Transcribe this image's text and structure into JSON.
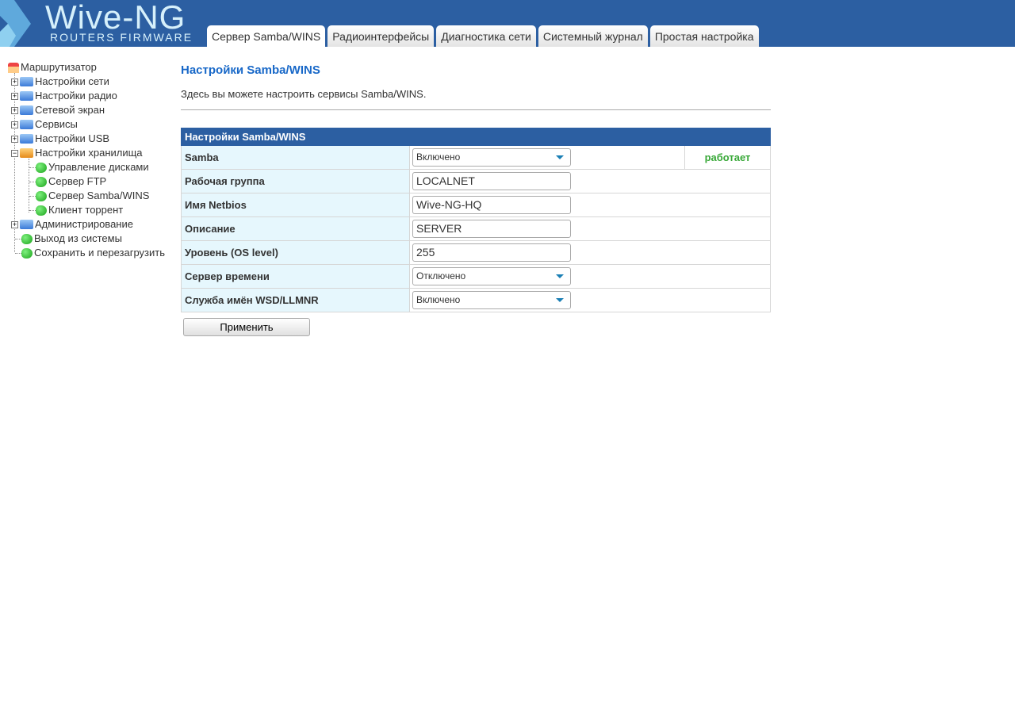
{
  "logo": {
    "title": "Wive-NG",
    "subtitle": "ROUTERS FIRMWARE"
  },
  "tabs": [
    "Сервер Samba/WINS",
    "Радиоинтерфейсы",
    "Диагностика сети",
    "Системный журнал",
    "Простая настройка"
  ],
  "tree": {
    "root": "Маршрутизатор",
    "items": [
      "Настройки сети",
      "Настройки радио",
      "Сетевой экран",
      "Сервисы",
      "Настройки USB",
      "Настройки хранилища"
    ],
    "storage_children": [
      "Управление дисками",
      "Сервер FTP",
      "Сервер Samba/WINS",
      "Клиент торрент"
    ],
    "admin": "Администрирование",
    "logout": "Выход из системы",
    "save_reboot": "Сохранить и перезагрузить"
  },
  "page": {
    "title": "Настройки Samba/WINS",
    "description": "Здесь вы можете настроить сервисы Samba/WINS.",
    "table_title": "Настройки Samba/WINS",
    "rows": [
      {
        "label": "Samba",
        "value": "Включено",
        "status": "работает"
      },
      {
        "label": "Рабочая группа",
        "value": "LOCALNET"
      },
      {
        "label": "Имя Netbios",
        "value": "Wive-NG-HQ"
      },
      {
        "label": "Описание",
        "value": "SERVER"
      },
      {
        "label": "Уровень (OS level)",
        "value": "255"
      },
      {
        "label": "Сервер времени",
        "value": "Отключено"
      },
      {
        "label": "Служба имён WSD/LLMNR",
        "value": "Включено"
      }
    ],
    "apply": "Применить"
  }
}
